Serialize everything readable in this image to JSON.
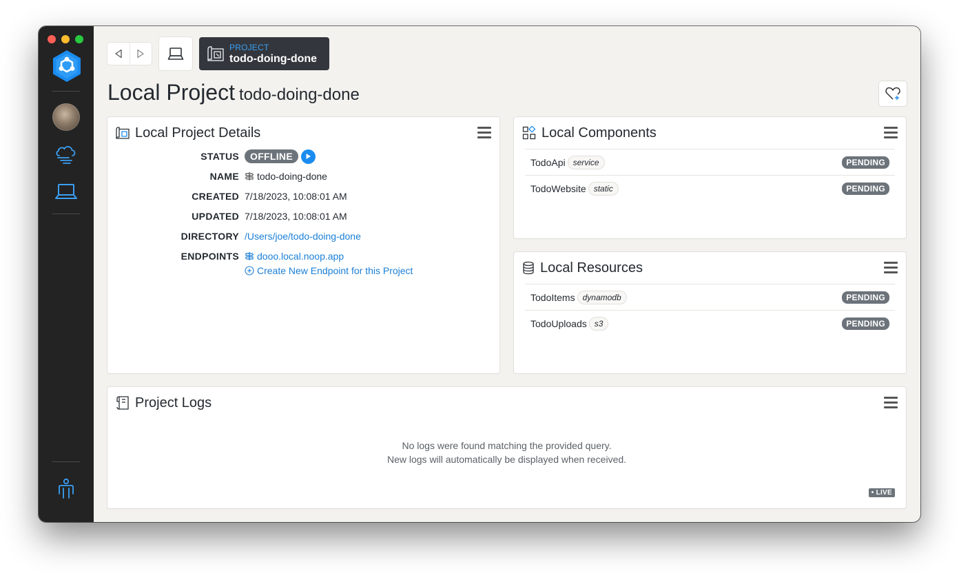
{
  "window": {
    "traffic_lights": {
      "close": "#fe5f57",
      "minimize": "#febc2e",
      "zoom": "#28c840"
    }
  },
  "sidebar": {
    "items": [
      {
        "icon": "app-logo-icon"
      },
      {
        "icon": "user-avatar"
      },
      {
        "icon": "cloud-icon"
      },
      {
        "icon": "laptop-icon",
        "active": true
      },
      {
        "icon": "account-person-icon"
      }
    ],
    "active_color": "#1a8cf0"
  },
  "toolbar": {
    "back_icon": "back-triangle-icon",
    "forward_icon": "forward-triangle-icon",
    "home_icon": "laptop-icon"
  },
  "breadcrumb": {
    "kicker": "PROJECT",
    "name": "todo-doing-done"
  },
  "page": {
    "title": "Local Project",
    "subtitle": "todo-doing-done"
  },
  "details": {
    "title": "Local Project Details",
    "status_label": "STATUS",
    "status_value": "OFFLINE",
    "name_label": "NAME",
    "name_value": "todo-doing-done",
    "created_label": "CREATED",
    "created_value": "7/18/2023, 10:08:01 AM",
    "updated_label": "UPDATED",
    "updated_value": "7/18/2023, 10:08:01 AM",
    "directory_label": "DIRECTORY",
    "directory_value": "/Users/joe/todo-doing-done",
    "endpoints_label": "ENDPOINTS",
    "endpoint_value": "dooo.local.noop.app",
    "create_endpoint": "Create New Endpoint for this Project"
  },
  "components": {
    "title": "Local Components",
    "rows": [
      {
        "name": "TodoApi",
        "kind": "service",
        "status": "PENDING"
      },
      {
        "name": "TodoWebsite",
        "kind": "static",
        "status": "PENDING"
      }
    ]
  },
  "resources": {
    "title": "Local Resources",
    "rows": [
      {
        "name": "TodoItems",
        "kind": "dynamodb",
        "status": "PENDING"
      },
      {
        "name": "TodoUploads",
        "kind": "s3",
        "status": "PENDING"
      }
    ]
  },
  "logs": {
    "title": "Project Logs",
    "empty_line1": "No logs were found matching the provided query.",
    "empty_line2": "New logs will automatically be displayed when received.",
    "live_badge": "• LIVE"
  },
  "colors": {
    "accent": "#1a8cf0",
    "badge_gray": "#6c737a",
    "breadcrumb_bg": "#33373d",
    "sidebar_bg": "#232323",
    "content_bg": "#f3f2ef"
  }
}
